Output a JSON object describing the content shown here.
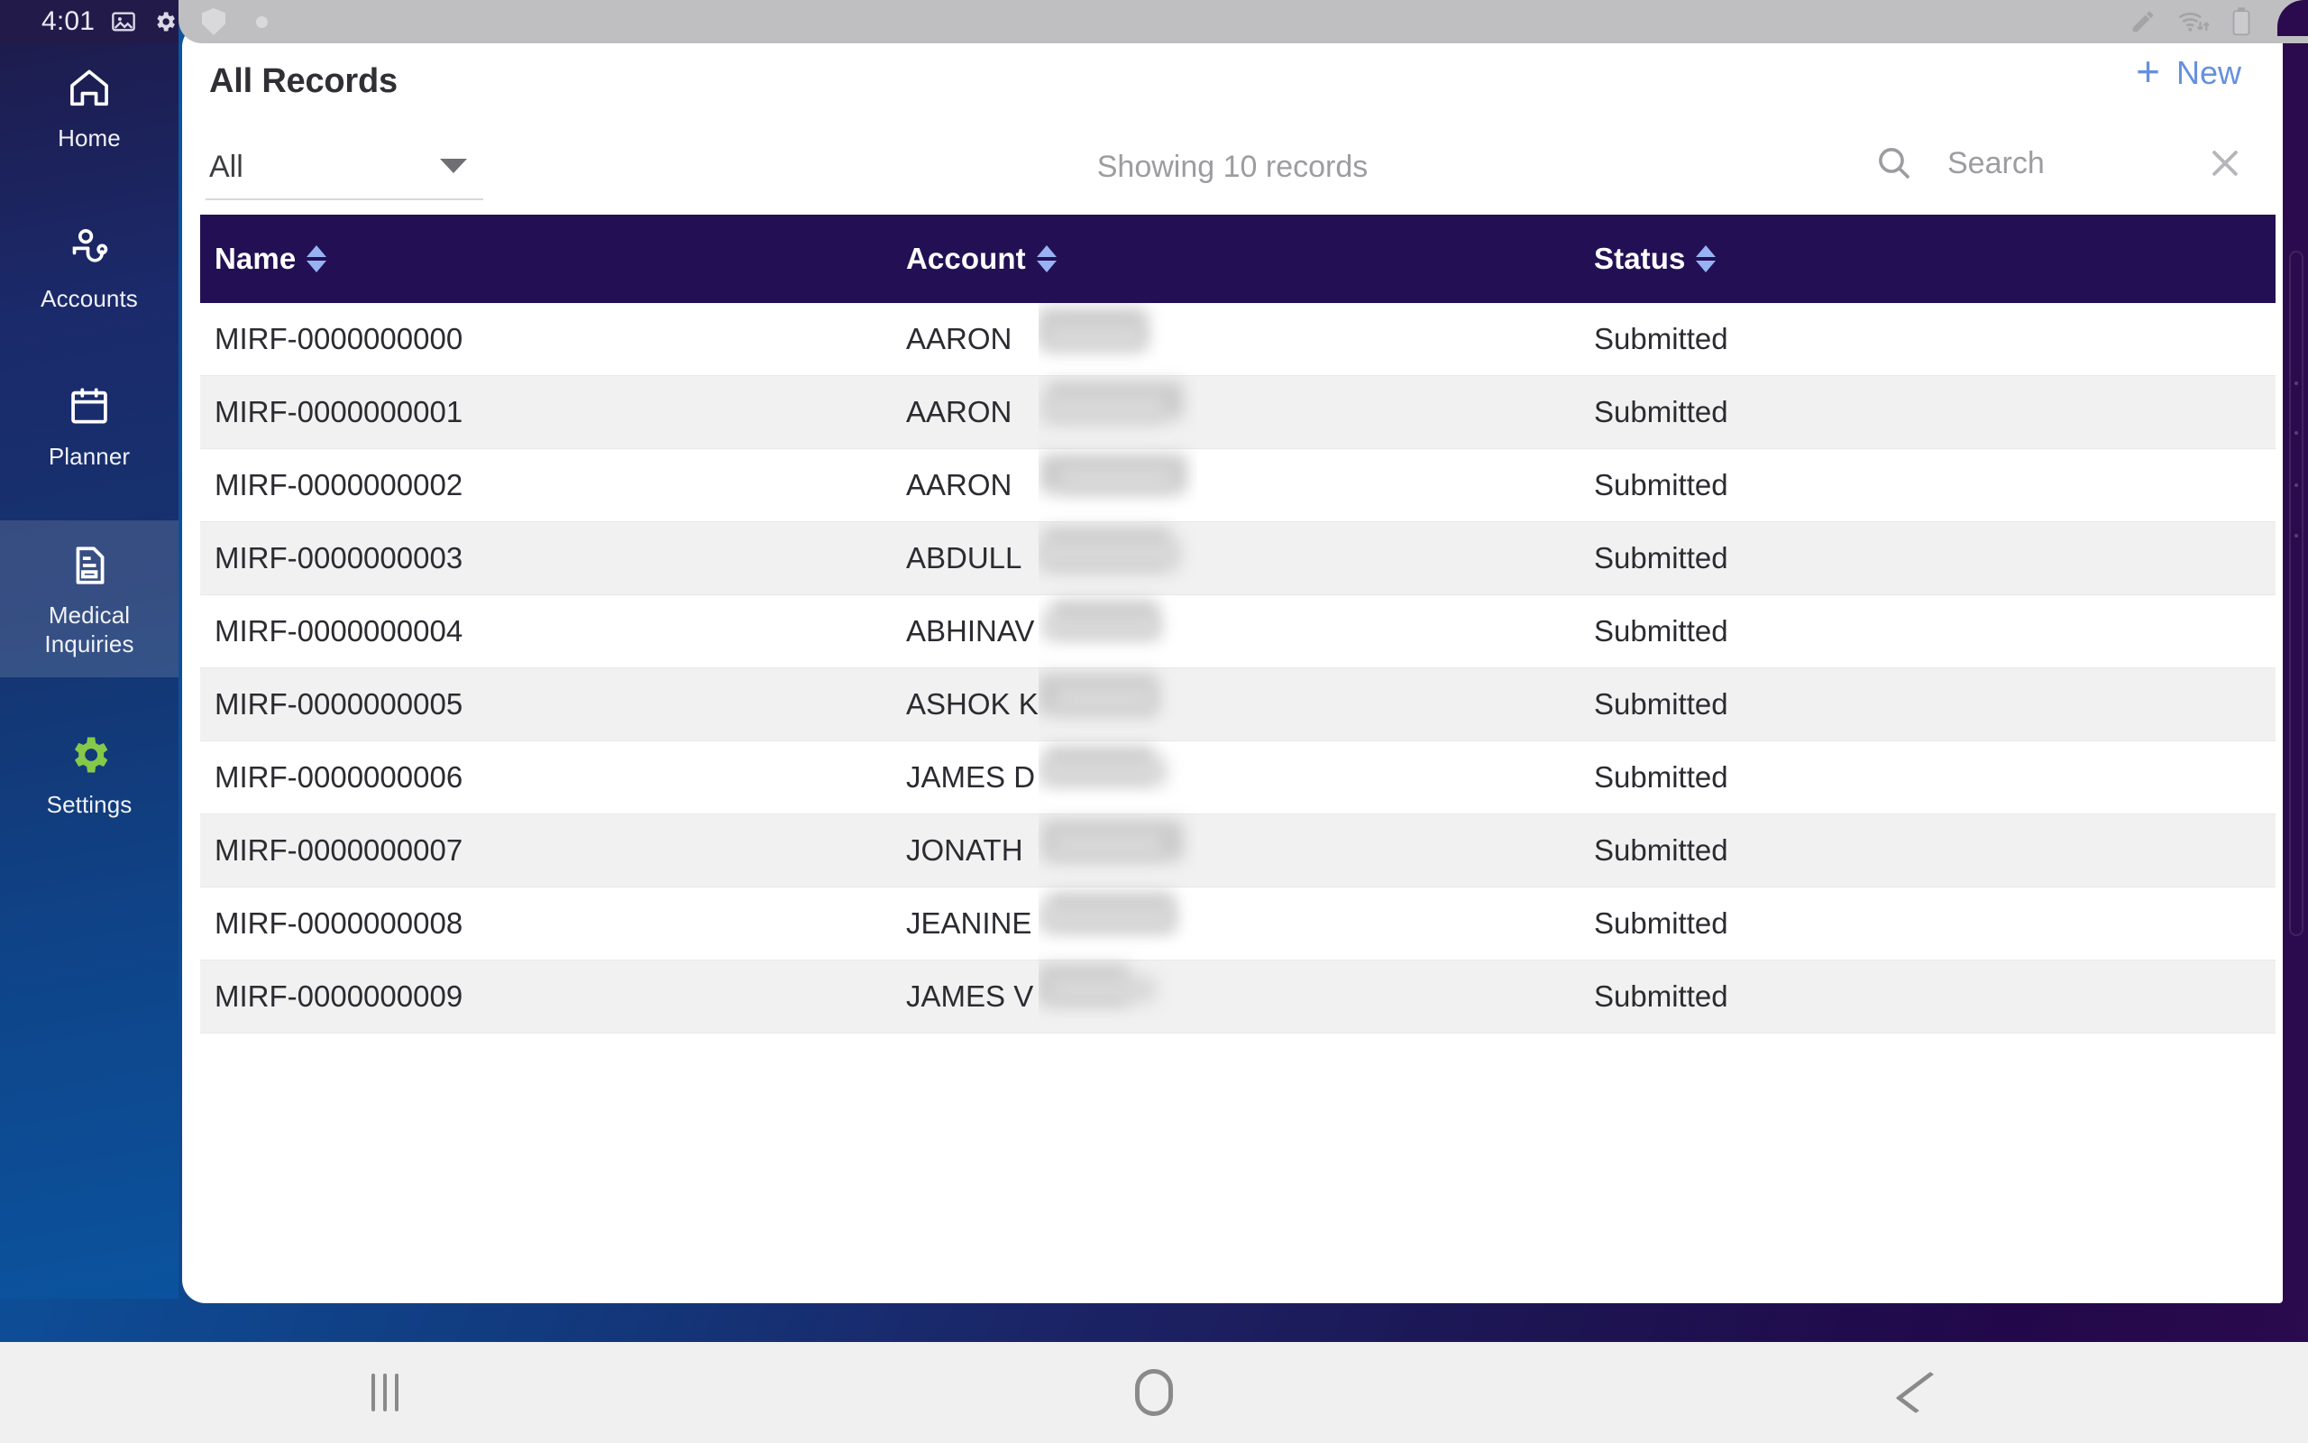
{
  "status_bar": {
    "time": "4:01",
    "left_icons": [
      "image-icon",
      "gear-icon"
    ],
    "notch_icons": [
      "shield-icon",
      "dot-indicator"
    ],
    "right_icons": [
      "pencil-icon",
      "wifi-data-icon",
      "battery-icon"
    ]
  },
  "sidebar": {
    "items": [
      {
        "label": "Home",
        "icon": "home-icon",
        "active": false
      },
      {
        "label": "Accounts",
        "icon": "doctor-icon",
        "active": false
      },
      {
        "label": "Planner",
        "icon": "calendar-icon",
        "active": false
      },
      {
        "label": "Medical\nInquiries",
        "icon": "document-icon",
        "active": true
      },
      {
        "label": "Settings",
        "icon": "gear-icon-green",
        "active": false
      }
    ],
    "medical_inquiries_line1": "Medical",
    "medical_inquiries_line2": "Inquiries"
  },
  "header": {
    "title": "All Records",
    "new_plus": "+",
    "new_label": "New"
  },
  "toolbar": {
    "filter_value": "All",
    "filter_caret": "chevron-down-icon",
    "showing_text": "Showing 10 records",
    "search_placeholder": "Search",
    "search_value": "",
    "search_icon": "search-icon",
    "clear_icon": "close-icon"
  },
  "table": {
    "columns": [
      {
        "label": "Name",
        "sortable": true
      },
      {
        "label": "Account",
        "sortable": true
      },
      {
        "label": "Status",
        "sortable": true
      }
    ],
    "rows": [
      {
        "name": "MIRF-0000000000",
        "account": "AARON",
        "status": "Submitted"
      },
      {
        "name": "MIRF-0000000001",
        "account": "AARON",
        "status": "Submitted"
      },
      {
        "name": "MIRF-0000000002",
        "account": "AARON",
        "status": "Submitted"
      },
      {
        "name": "MIRF-0000000003",
        "account": "ABDULL",
        "status": "Submitted"
      },
      {
        "name": "MIRF-0000000004",
        "account": "ABHINAV",
        "status": "Submitted"
      },
      {
        "name": "MIRF-0000000005",
        "account": "ASHOK K",
        "status": "Submitted"
      },
      {
        "name": "MIRF-0000000006",
        "account": "JAMES D",
        "status": "Submitted"
      },
      {
        "name": "MIRF-0000000007",
        "account": "JONATH",
        "status": "Submitted"
      },
      {
        "name": "MIRF-0000000008",
        "account": "JEANINE",
        "status": "Submitted"
      },
      {
        "name": "MIRF-0000000009",
        "account": "JAMES V",
        "status": "Submitted"
      }
    ]
  },
  "bottom_nav": {
    "recents_label": "recents-icon",
    "home_label": "home-icon",
    "back_label": "back-icon"
  },
  "colors": {
    "sidebar_top": "#1d1c4e",
    "sidebar_bottom": "#0b539e",
    "table_header": "#231054",
    "sort_arrow": "#97b3f3",
    "accent_new": "#6690df",
    "settings_green": "#86c94a",
    "row_alt": "#f1f1f1",
    "rail": "#2b0b4d"
  }
}
